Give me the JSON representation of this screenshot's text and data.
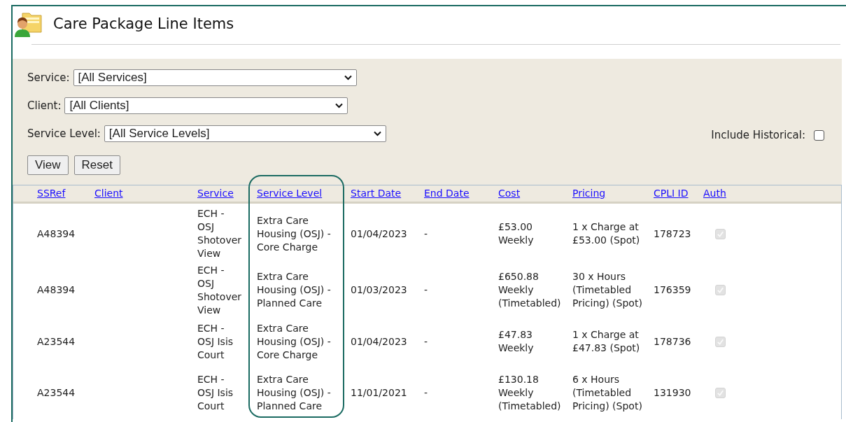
{
  "page": {
    "title": "Care Package Line Items"
  },
  "filters": [
    {
      "label": "Service:",
      "value": "[All Services]"
    },
    {
      "label": "Client:",
      "value": "[All Clients]"
    },
    {
      "label": "Service Level:",
      "value": "[All Service Levels]"
    }
  ],
  "include_historical": {
    "label": "Include Historical:",
    "checked": false
  },
  "buttons": [
    "View",
    "Reset"
  ],
  "table": {
    "columns": [
      "SSRef",
      "Client",
      "Service",
      "Service Level",
      "Start Date",
      "End Date",
      "Cost",
      "Pricing",
      "CPLI ID",
      "Auth"
    ],
    "rows": [
      {
        "ssref": "A48394",
        "service": "ECH - OSJ Shotover View",
        "service_level": "Extra Care Housing (OSJ) - Core Charge",
        "start_date": "01/04/2023",
        "end_date": "-",
        "cost": "£53.00 Weekly",
        "pricing": "1 x Charge at £53.00 (Spot)",
        "cpli_id": "178723",
        "auth": {
          "checked": true,
          "disabled": true
        }
      },
      {
        "ssref": "A48394",
        "service": "ECH - OSJ Shotover View",
        "service_level": "Extra Care Housing (OSJ) - Planned Care",
        "start_date": "01/03/2023",
        "end_date": "-",
        "cost": "£650.88 Weekly (Timetabled)",
        "pricing": "30 x Hours (Timetabled Pricing) (Spot)",
        "cpli_id": "176359",
        "auth": {
          "checked": true,
          "disabled": true
        }
      },
      {
        "ssref": "A23544",
        "service": "ECH - OSJ Isis Court",
        "service_level": "Extra Care Housing (OSJ) - Core Charge",
        "start_date": "01/04/2023",
        "end_date": "-",
        "cost": "£47.83 Weekly",
        "pricing": "1 x Charge at £47.83 (Spot)",
        "cpli_id": "178736",
        "auth": {
          "checked": true,
          "disabled": true
        }
      },
      {
        "ssref": "A23544",
        "service": "ECH - OSJ Isis Court",
        "service_level": "Extra Care Housing (OSJ) - Planned Care",
        "start_date": "11/01/2021",
        "end_date": "-",
        "cost": "£130.18 Weekly (Timetabled)",
        "pricing": "6 x Hours (Timetabled Pricing) (Spot)",
        "cpli_id": "131930",
        "auth": {
          "checked": true,
          "disabled": true
        }
      }
    ]
  }
}
